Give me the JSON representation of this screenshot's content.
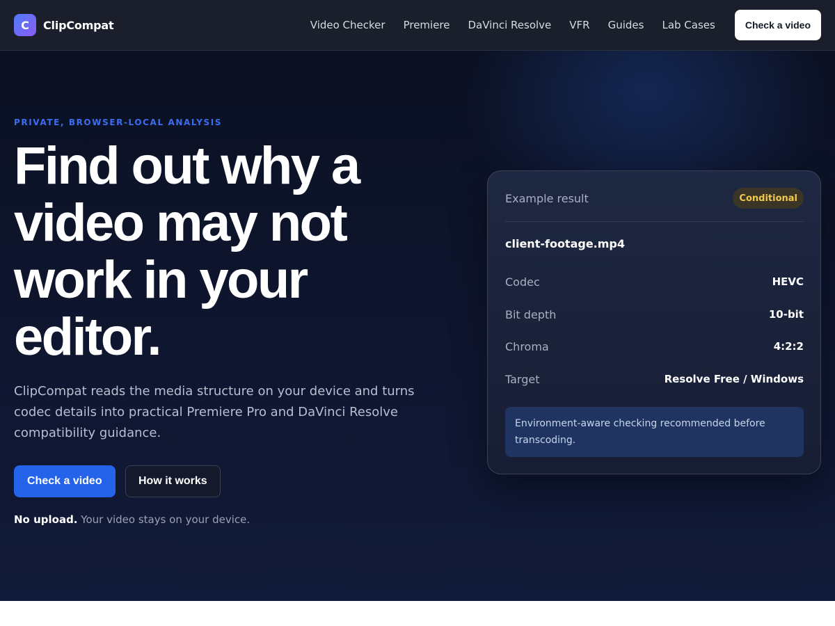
{
  "header": {
    "logo_letter": "C",
    "brand": "ClipCompat",
    "nav": [
      "Video Checker",
      "Premiere",
      "DaVinci Resolve",
      "VFR",
      "Guides",
      "Lab Cases"
    ],
    "cta": "Check a video"
  },
  "hero": {
    "eyebrow": "PRIVATE, BROWSER-LOCAL ANALYSIS",
    "headline": "Find out why a video may not work in your editor.",
    "lead": "ClipCompat reads the media structure on your device and turns codec details into practical Premiere Pro and DaVinci Resolve compatibility guidance.",
    "primary_button": "Check a video",
    "secondary_button": "How it works",
    "note_strong": "No upload.",
    "note_text": " Your video stays on your device."
  },
  "card": {
    "label": "Example result",
    "badge": "Conditional",
    "filename": "client-footage.mp4",
    "rows": [
      {
        "key": "Codec",
        "value": "HEVC"
      },
      {
        "key": "Bit depth",
        "value": "10-bit"
      },
      {
        "key": "Chroma",
        "value": "4:2:2"
      },
      {
        "key": "Target",
        "value": "Resolve Free / Windows"
      }
    ],
    "info": "Environment-aware checking recommended before transcoding."
  },
  "colors": {
    "accent": "#2563eb",
    "badge_text": "#f2c94c",
    "background": "#0f1630"
  }
}
